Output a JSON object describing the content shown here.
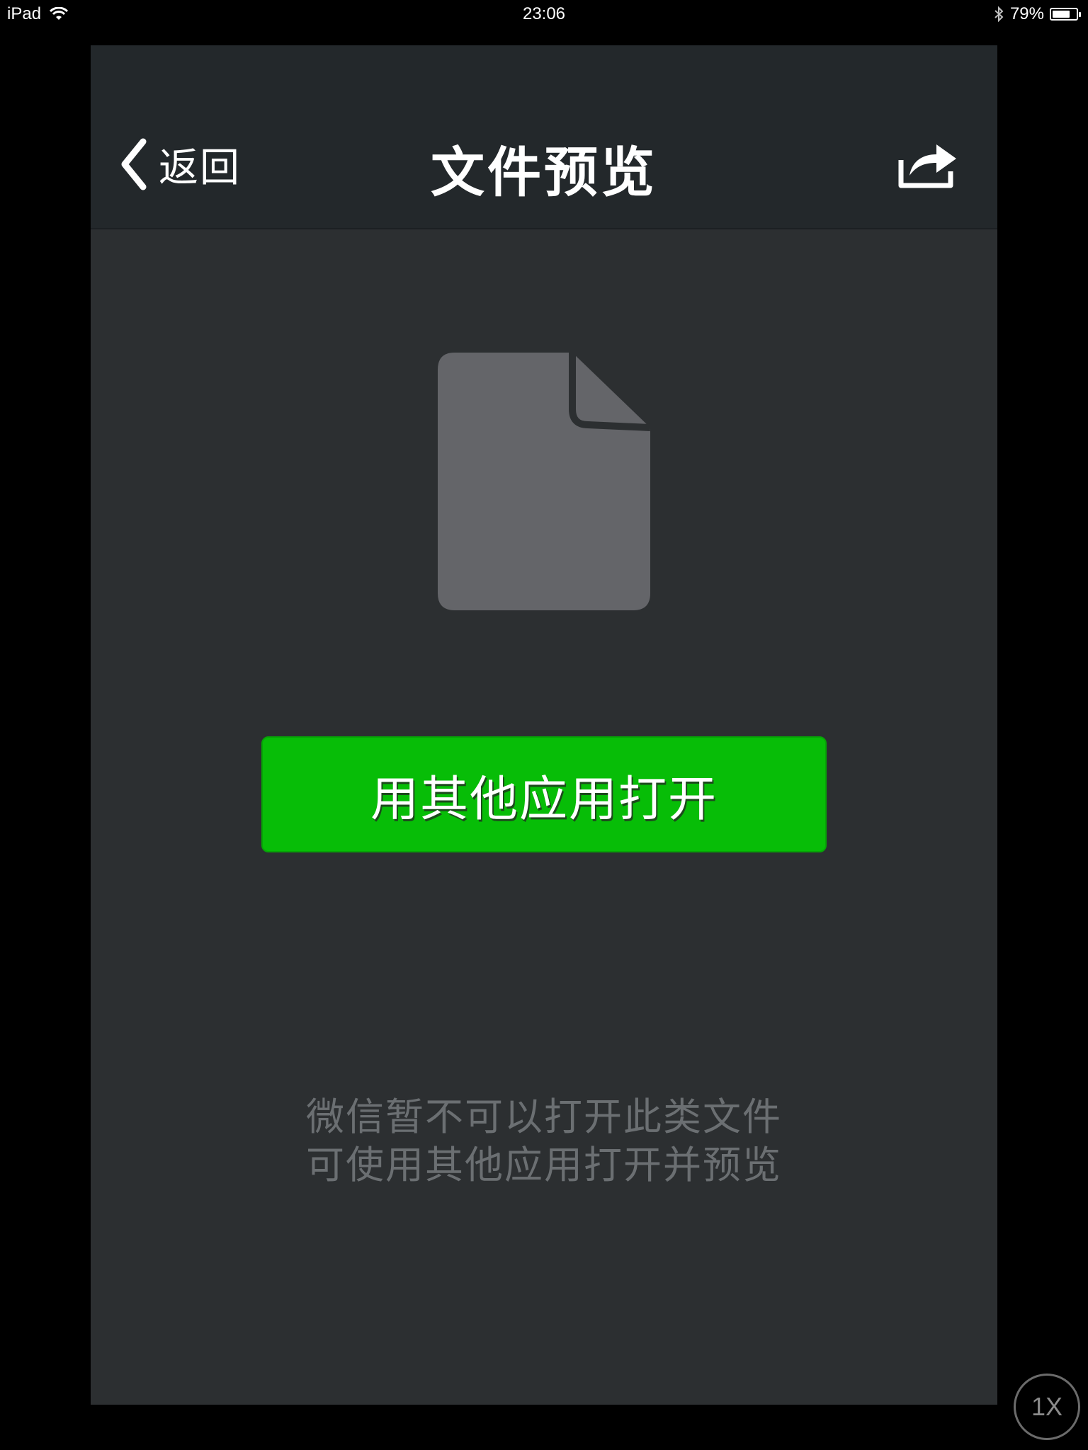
{
  "status_bar": {
    "device": "iPad",
    "time": "23:06",
    "battery_percent": "79%",
    "battery_level": 0.79,
    "icons": [
      "wifi-icon",
      "bluetooth-icon",
      "battery-icon"
    ]
  },
  "navbar": {
    "back_label": "返回",
    "title": "文件预览",
    "icons": [
      "chevron-left-icon",
      "share-icon"
    ]
  },
  "main": {
    "file_icon": "file-icon",
    "open_button_label": "用其他应用打开",
    "hint_line1": "微信暂不可以打开此类文件",
    "hint_line2": "可使用其他应用打开并预览"
  },
  "zoom": {
    "label": "1X"
  },
  "colors": {
    "background": "#000000",
    "app_background": "#2c2f31",
    "navbar_background": "#23282b",
    "primary_button": "#07bd07",
    "file_icon": "#646569",
    "hint_text": "#6b6f72"
  }
}
